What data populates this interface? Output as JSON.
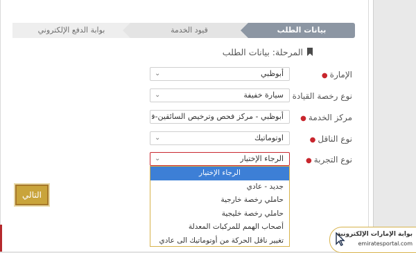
{
  "steps": {
    "step1": "بيانات الطلب",
    "step2": "قيود الخدمة",
    "step3": "بوابة الدفع الإلكتروني"
  },
  "stage": {
    "text": "المرحلة: بيانات الطلب"
  },
  "form": {
    "emirate": {
      "label": "الإمارة",
      "value": "أبوظبي"
    },
    "license_type": {
      "label": "نوع رخصة القيادة",
      "value": "سيارة خفيفة"
    },
    "service_center": {
      "label": "مركز الخدمة",
      "value": "أبوظبي - مركز فحص وترخيص السائقين-فحص"
    },
    "transmission": {
      "label": "نوع الناقل",
      "value": "اوتوماتيك"
    },
    "experience_type": {
      "label": "نوع التجربة",
      "value": "الرجاء الإختيار"
    }
  },
  "dropdown": {
    "options": [
      "الرجاء الإختيار",
      "جديد - عادي",
      "حاملي رخصة خارجية",
      "حاملي رخصة خليجية",
      "أصحاب الهمم للمركبات المعدلة",
      "تغيير ناقل الحركة من أوتوماتيك الى عادي"
    ]
  },
  "buttons": {
    "next": "التالي"
  },
  "logo": {
    "arabic": "بوابة الإمارات الإلكترونية",
    "english": "emiratesportal.com"
  },
  "colors": {
    "accent_red": "#c8262d",
    "step_active": "#8c96a3",
    "button_gold": "#c9a43b",
    "selected_blue": "#3d7fd6"
  }
}
